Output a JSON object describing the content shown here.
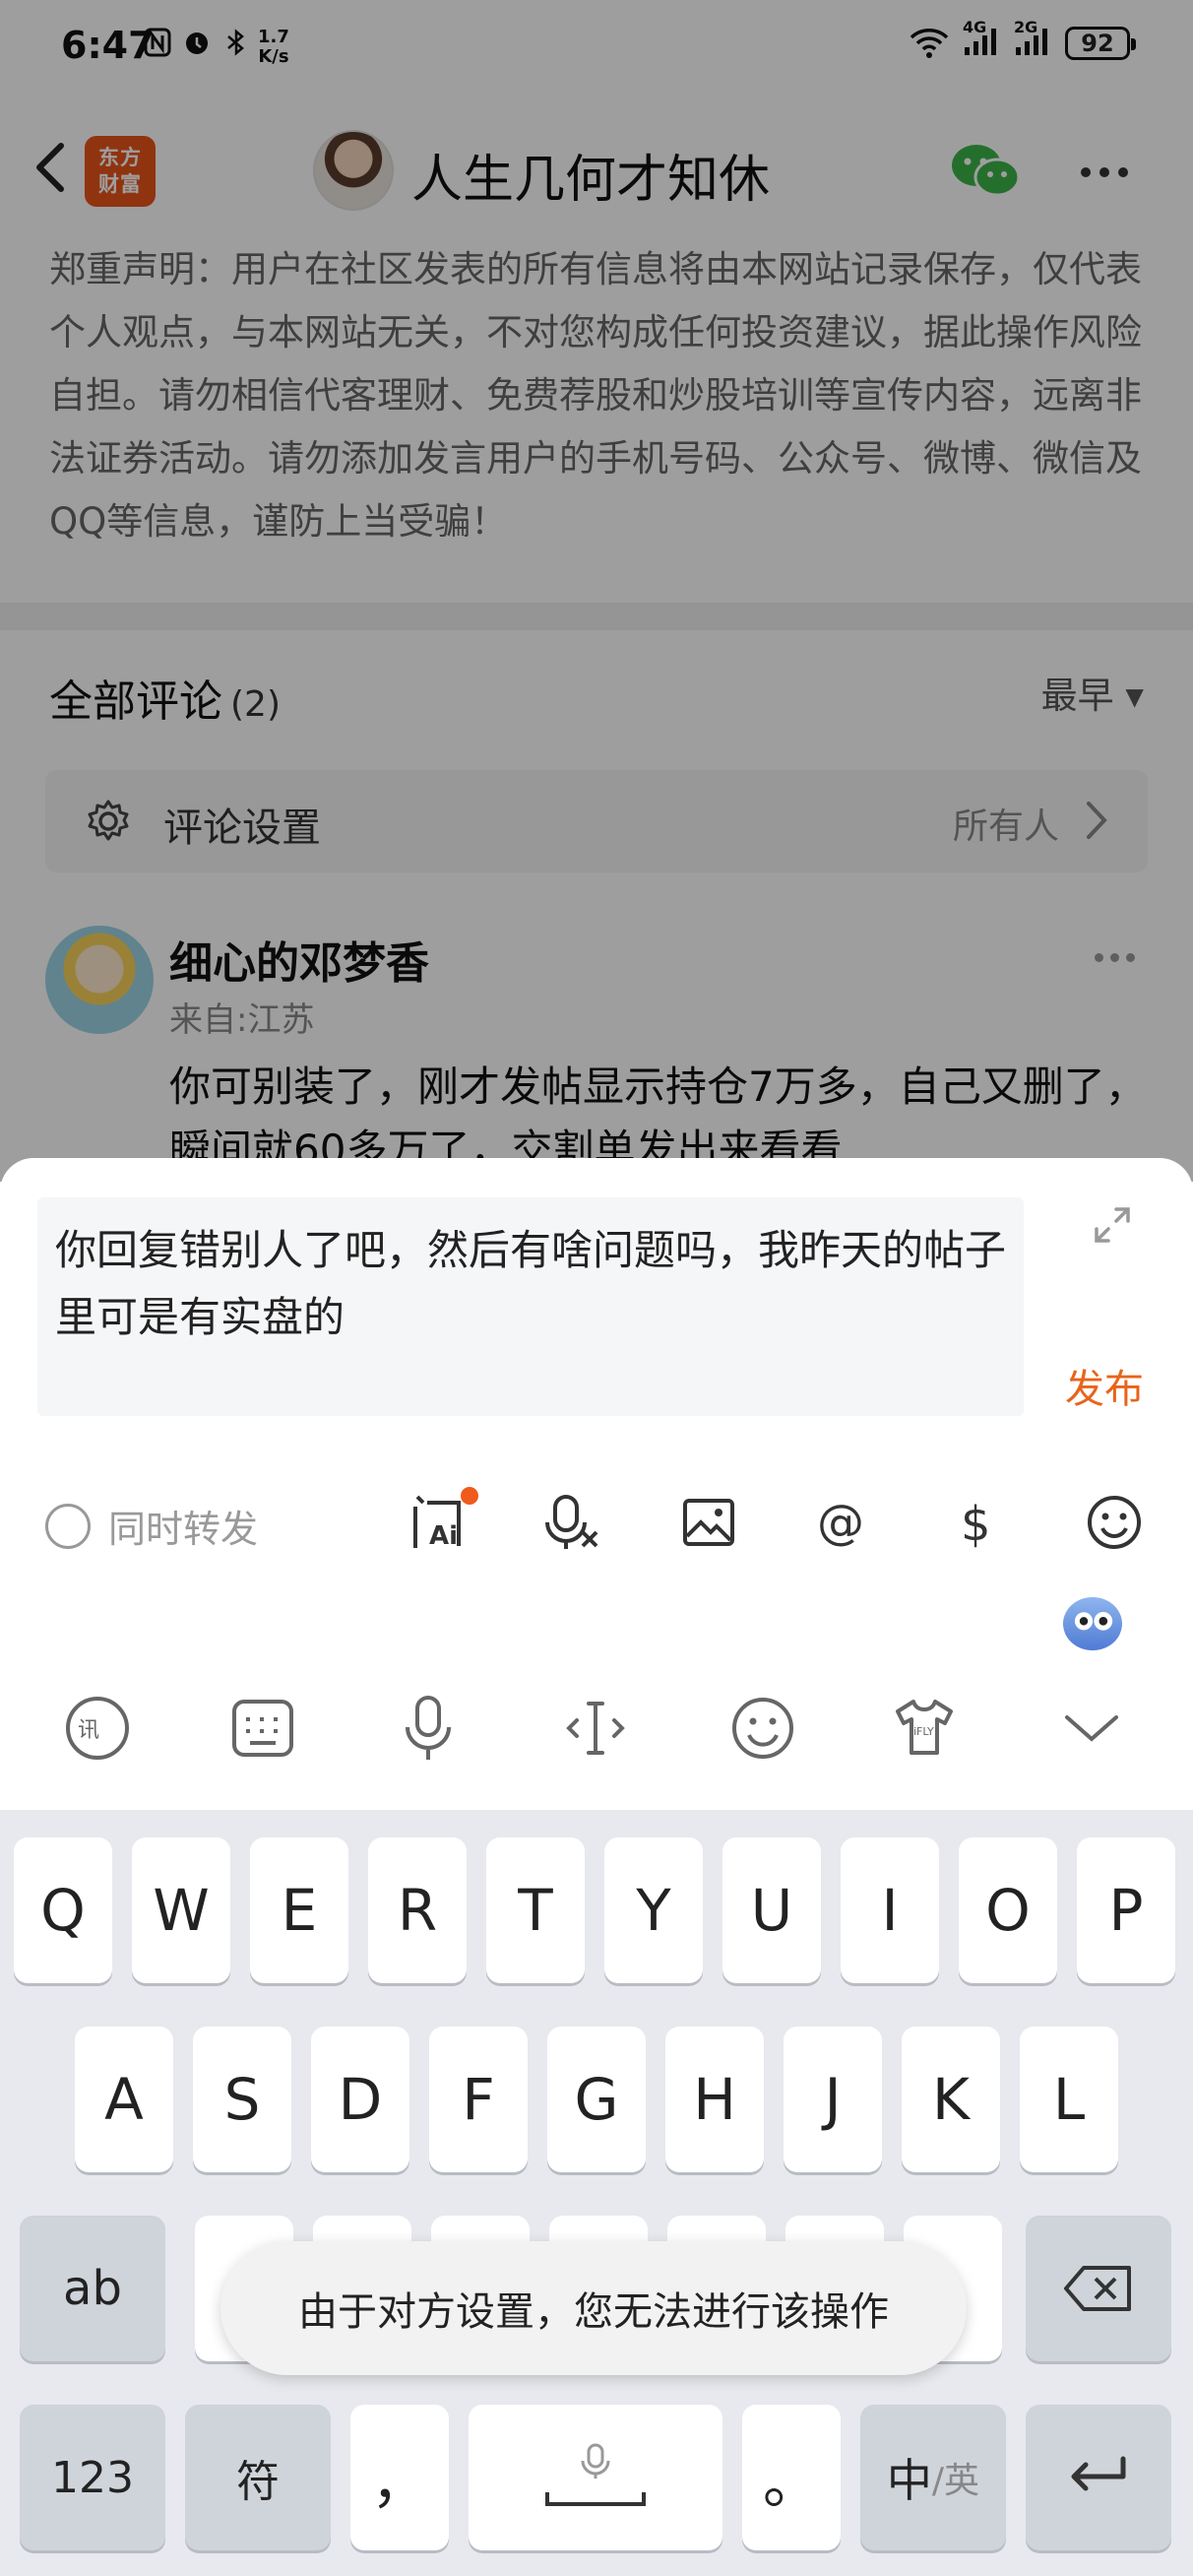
{
  "status_bar": {
    "time": "6:47",
    "speed_value": "1.7",
    "speed_unit": "K/s",
    "net1": "4G",
    "net2": "2G",
    "battery": "92"
  },
  "header": {
    "logo_line1": "东方",
    "logo_line2": "财富",
    "title": "人生几何才知休"
  },
  "disclaimer": "郑重声明：用户在社区发表的所有信息将由本网站记录保存，仅代表个人观点，与本网站无关，不对您构成任何投资建议，据此操作风险自担。请勿相信代客理财、免费荐股和炒股培训等宣传内容，远离非法证券活动。请勿添加发言用户的手机号码、公众号、微博、微信及QQ等信息，谨防上当受骗！",
  "comments": {
    "heading": "全部评论",
    "count": "(2)",
    "sort": "最早 ▾",
    "settings_label": "评论设置",
    "settings_value": "所有人"
  },
  "comment": {
    "user": "细心的邓梦香",
    "location": "来自:江苏",
    "text": "你可别装了，刚才发帖显示持仓7万多，自己又删了，瞬间就60多万了，交割单发出来看看"
  },
  "reply": {
    "text": "你回复错别人了吧，然后有啥问题吗，我昨天的帖子里可是有实盘的",
    "publish": "发布",
    "repost_label": "同时转发"
  },
  "keyboard": {
    "row1": [
      "Q",
      "W",
      "E",
      "R",
      "T",
      "Y",
      "U",
      "I",
      "O",
      "P"
    ],
    "row2": [
      "A",
      "S",
      "D",
      "F",
      "G",
      "H",
      "J",
      "K",
      "L"
    ],
    "shift_label": "ab",
    "num_label": "123",
    "symbol_label": "符",
    "comma": "，",
    "period": "。",
    "lang_main": "中",
    "lang_sub": "/英"
  },
  "toast": "由于对方设置，您无法进行该操作",
  "colors": {
    "accent": "#e8641b",
    "dim": "rgba(0,0,0,0.38)"
  }
}
